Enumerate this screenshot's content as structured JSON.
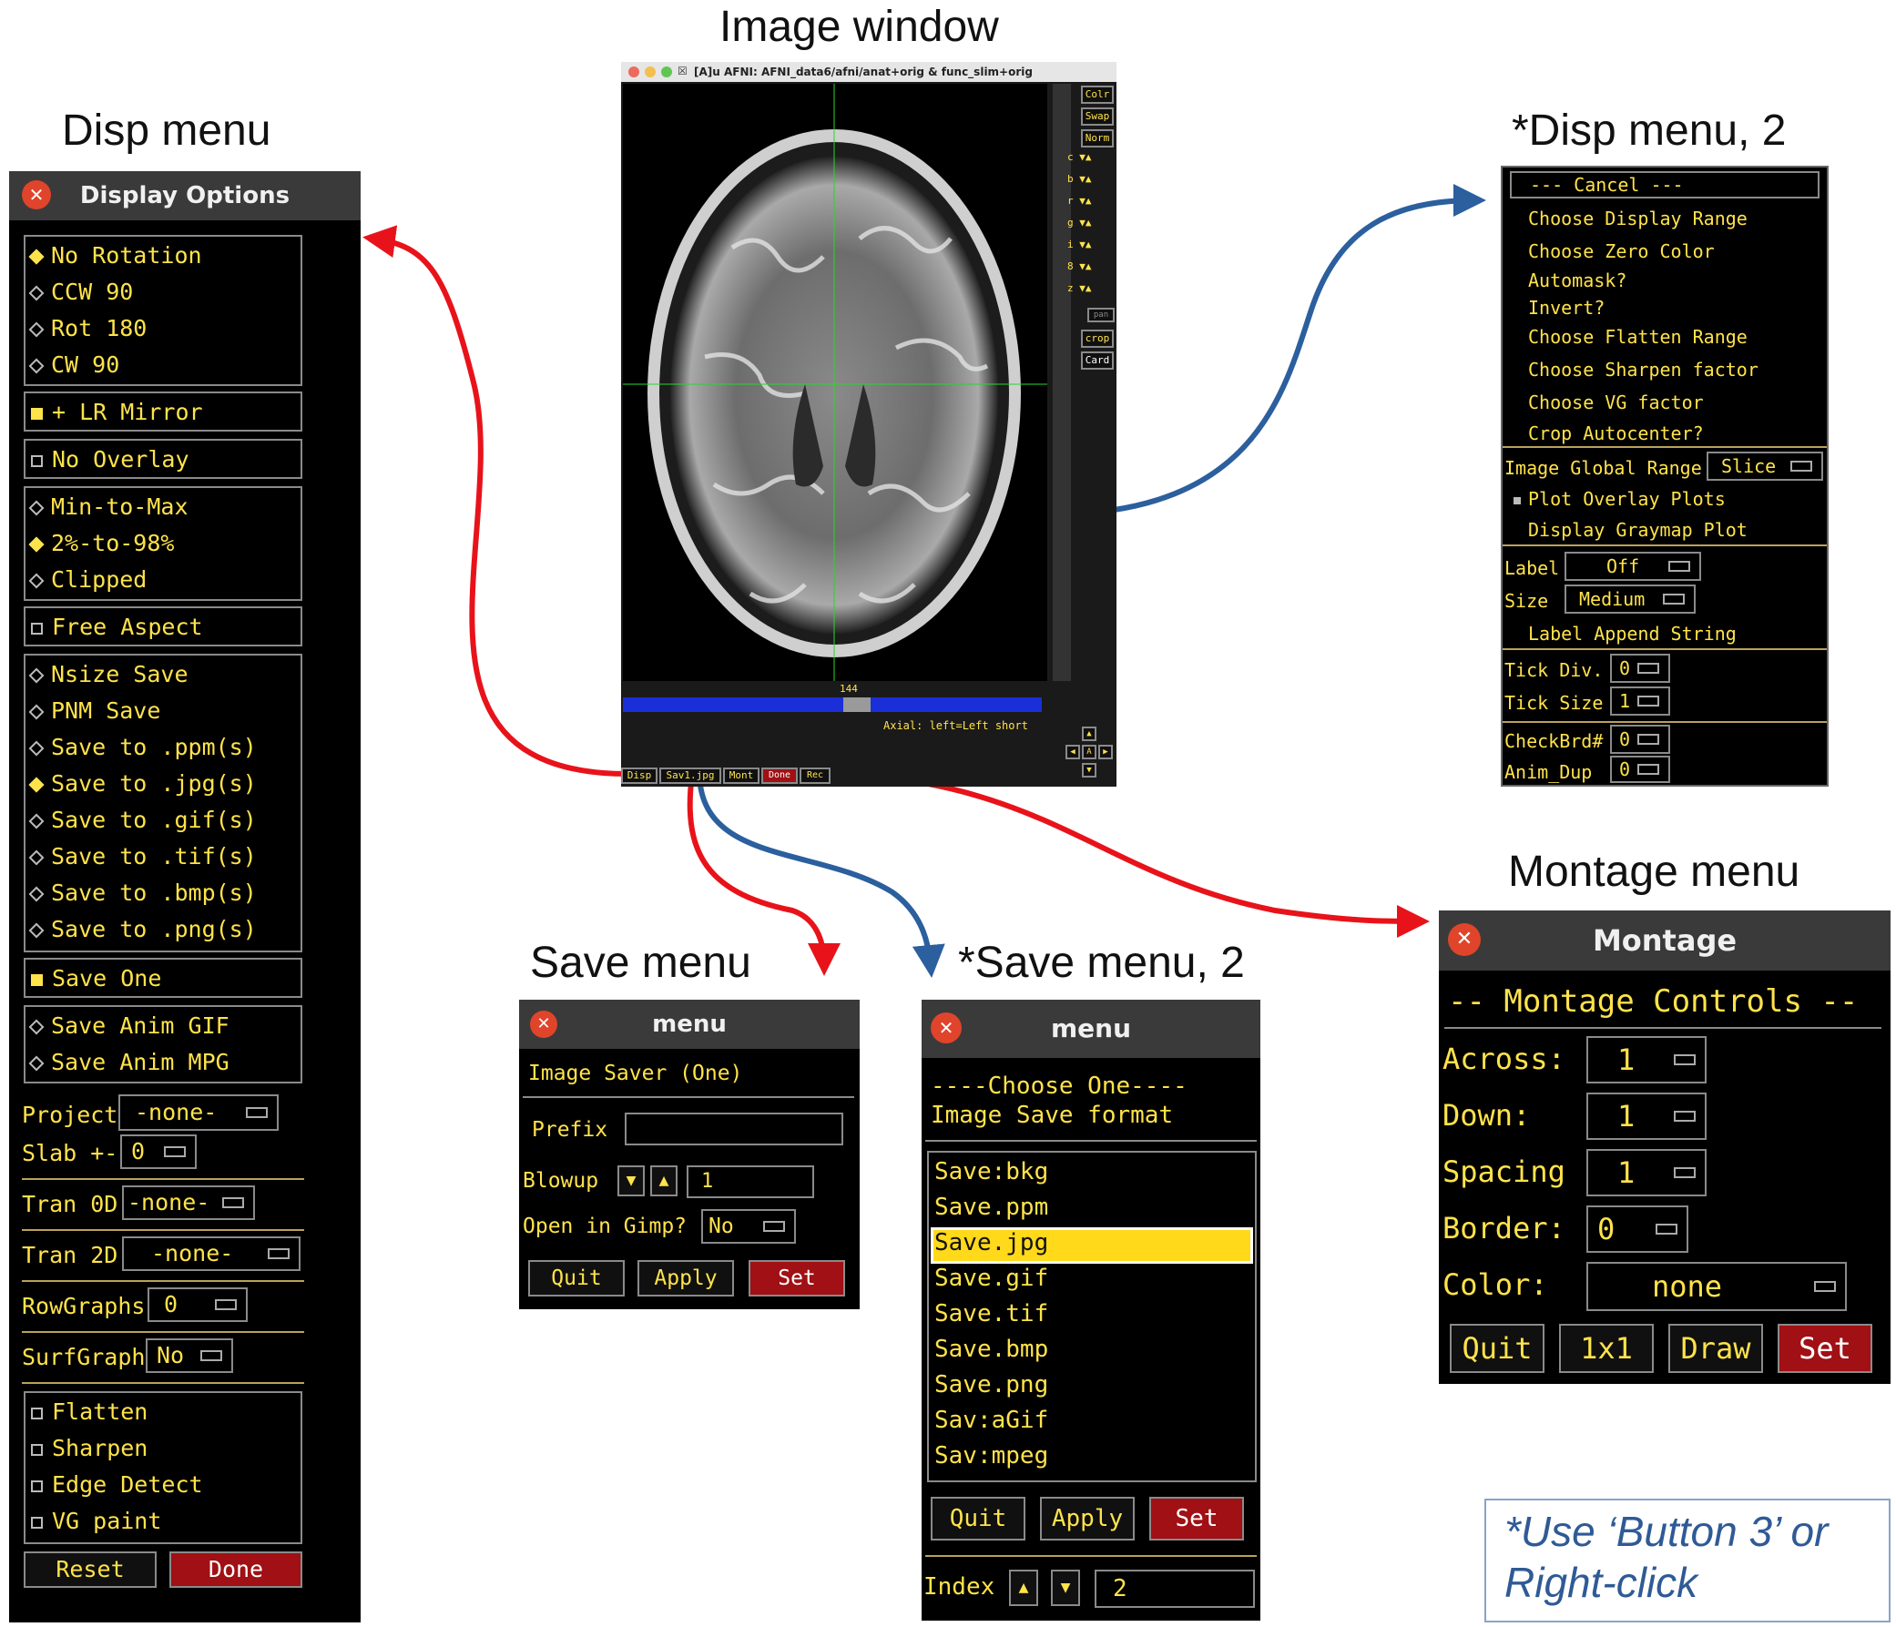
{
  "titles": {
    "image_window": "Image window",
    "disp_menu": "Disp menu",
    "disp_menu_2": "*Disp menu, 2",
    "save_menu": "Save menu",
    "save_menu_2": "*Save menu, 2",
    "montage_menu": "Montage menu"
  },
  "note": {
    "line1": "*Use ‘Button 3’ or",
    "line2": "Right-click"
  },
  "colors": {
    "arrow_red": "#e8131a",
    "arrow_blue": "#2b5f9e",
    "accent_yellow": "#ffe34a",
    "set_button_red": "#a01014"
  },
  "image_window": {
    "title": "[A]u AFNI: AFNI_data6/afni/anat+orig & func_slim+orig",
    "side_buttons": [
      "Colr",
      "Swap",
      "Norm",
      "c",
      "b",
      "r",
      "g",
      "i",
      "8",
      "z",
      "pan",
      "crop",
      "Card"
    ],
    "slider_value": "144",
    "orientation_label": "Axial: left=Left short",
    "bottom_buttons": [
      "Disp",
      "Sav1.jpg",
      "Mont",
      "Done",
      "Rec"
    ],
    "nav_buttons": [
      "▲",
      "◀",
      "A",
      "▶",
      "▼"
    ]
  },
  "disp_menu": {
    "title": "Display Options",
    "rotation": [
      "No Rotation",
      "CCW 90",
      "Rot 180",
      "CW 90"
    ],
    "rotation_selected": 0,
    "lr_mirror": "+ LR Mirror",
    "no_overlay": "No Overlay",
    "range": [
      "Min-to-Max",
      "2%-to-98%",
      "Clipped"
    ],
    "range_selected": 1,
    "free_aspect": "Free Aspect",
    "save_formats": [
      "Nsize Save",
      "PNM Save",
      "Save to .ppm(s)",
      "Save to .jpg(s)",
      "Save to .gif(s)",
      "Save to .tif(s)",
      "Save to .bmp(s)",
      "Save to .png(s)"
    ],
    "save_selected": 3,
    "save_one": "Save One",
    "anim": [
      "Save Anim GIF",
      "Save Anim MPG"
    ],
    "project_label": "Project",
    "project_value": "-none-",
    "slab_label": "Slab +-",
    "slab_value": "0",
    "tran0d_label": "Tran 0D",
    "tran0d_value": "-none-",
    "tran2d_label": "Tran 2D",
    "tran2d_value": "-none-",
    "rowgraphs_label": "RowGraphs",
    "rowgraphs_value": "0",
    "surfgraph_label": "SurfGraph",
    "surfgraph_value": "No",
    "filters": [
      "Flatten",
      "Sharpen",
      "Edge Detect",
      "VG paint"
    ],
    "reset": "Reset",
    "done": "Done"
  },
  "disp_menu_2": {
    "cancel": "--- Cancel ---",
    "items": [
      "Choose Display Range",
      "Choose Zero Color",
      "Automask?",
      "Invert?",
      "Choose Flatten Range",
      "Choose Sharpen factor",
      "Choose VG factor",
      "Crop Autocenter?"
    ],
    "global_range_label": "Image Global Range",
    "global_range_value": "Slice",
    "plot_overlay": "Plot Overlay Plots",
    "graymap": "Display Graymap Plot",
    "label_label": "Label",
    "label_value": "Off",
    "size_label": "Size",
    "size_value": "Medium",
    "label_append": "Label Append String",
    "tick_div_label": "Tick Div.",
    "tick_div_value": "0",
    "tick_size_label": "Tick Size",
    "tick_size_value": "1",
    "checkbrd_label": "CheckBrd#",
    "checkbrd_value": "0",
    "anim_dup_label": "Anim_Dup",
    "anim_dup_value": "0"
  },
  "save_menu": {
    "title": "menu",
    "header": "Image Saver (One)",
    "prefix_label": "Prefix",
    "prefix_value": "",
    "blowup_label": "Blowup",
    "blowup_value": "1",
    "gimp_label": "Open in Gimp?",
    "gimp_value": "No",
    "quit": "Quit",
    "apply": "Apply",
    "set": "Set"
  },
  "save_menu_2": {
    "title": "menu",
    "header1": "----Choose One----",
    "header2": "Image Save format",
    "formats": [
      "Save:bkg",
      "Save.ppm",
      "Save.jpg",
      "Save.gif",
      "Save.tif",
      "Save.bmp",
      "Save.png",
      "Sav:aGif",
      "Sav:mpeg"
    ],
    "selected": 2,
    "quit": "Quit",
    "apply": "Apply",
    "set": "Set",
    "index_label": "Index",
    "index_value": "2"
  },
  "montage_menu": {
    "title": "Montage",
    "header": "-- Montage Controls --",
    "across_label": "Across:",
    "across_value": "1",
    "down_label": "Down:",
    "down_value": "1",
    "spacing_label": "Spacing",
    "spacing_value": "1",
    "border_label": "Border:",
    "border_value": "0",
    "color_label": "Color:",
    "color_value": "none",
    "quit": "Quit",
    "one_by_one": "1x1",
    "draw": "Draw",
    "set": "Set"
  }
}
